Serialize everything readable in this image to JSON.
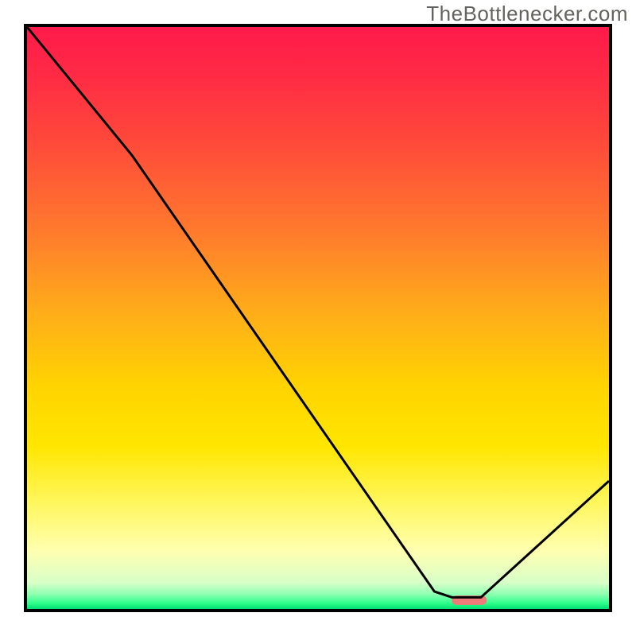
{
  "watermark": "TheBottlenecker.com",
  "frame": {
    "border_color": "#000000",
    "border_width": 4
  },
  "gradient_stops": [
    {
      "offset": 0.0,
      "color": "#ff1a4a"
    },
    {
      "offset": 0.08,
      "color": "#ff2a45"
    },
    {
      "offset": 0.2,
      "color": "#ff4a3a"
    },
    {
      "offset": 0.35,
      "color": "#ff7a2d"
    },
    {
      "offset": 0.5,
      "color": "#ffb018"
    },
    {
      "offset": 0.62,
      "color": "#ffd400"
    },
    {
      "offset": 0.72,
      "color": "#ffe600"
    },
    {
      "offset": 0.82,
      "color": "#fff760"
    },
    {
      "offset": 0.9,
      "color": "#ffffb0"
    },
    {
      "offset": 0.955,
      "color": "#d8ffc8"
    },
    {
      "offset": 0.975,
      "color": "#8cffb0"
    },
    {
      "offset": 0.99,
      "color": "#2fff8c"
    },
    {
      "offset": 1.0,
      "color": "#00e070"
    }
  ],
  "chart_data": {
    "type": "line",
    "title": "",
    "xlabel": "",
    "ylabel": "",
    "xlim": [
      0,
      100
    ],
    "ylim": [
      0,
      100
    ],
    "grid": false,
    "legend": false,
    "series": [
      {
        "name": "bottleneck-curve",
        "color": "#000000",
        "x": [
          0,
          18,
          70,
          73,
          78,
          100
        ],
        "values": [
          100,
          78,
          3,
          2,
          2,
          22
        ]
      }
    ],
    "marker": {
      "name": "optimal-range-marker",
      "color": "#ef7a7a",
      "x_start": 73,
      "x_end": 79,
      "y": 1.5,
      "thickness_pct": 1.6
    }
  }
}
